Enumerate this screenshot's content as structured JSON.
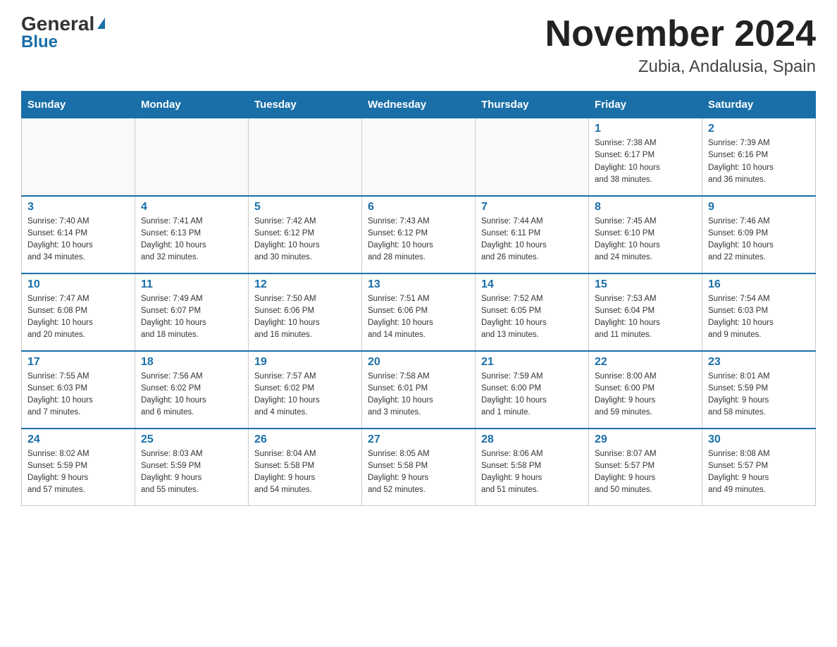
{
  "header": {
    "logo_general": "General",
    "logo_blue": "Blue",
    "title": "November 2024",
    "subtitle": "Zubia, Andalusia, Spain"
  },
  "weekdays": [
    "Sunday",
    "Monday",
    "Tuesday",
    "Wednesday",
    "Thursday",
    "Friday",
    "Saturday"
  ],
  "weeks": [
    [
      {
        "day": "",
        "info": ""
      },
      {
        "day": "",
        "info": ""
      },
      {
        "day": "",
        "info": ""
      },
      {
        "day": "",
        "info": ""
      },
      {
        "day": "",
        "info": ""
      },
      {
        "day": "1",
        "info": "Sunrise: 7:38 AM\nSunset: 6:17 PM\nDaylight: 10 hours\nand 38 minutes."
      },
      {
        "day": "2",
        "info": "Sunrise: 7:39 AM\nSunset: 6:16 PM\nDaylight: 10 hours\nand 36 minutes."
      }
    ],
    [
      {
        "day": "3",
        "info": "Sunrise: 7:40 AM\nSunset: 6:14 PM\nDaylight: 10 hours\nand 34 minutes."
      },
      {
        "day": "4",
        "info": "Sunrise: 7:41 AM\nSunset: 6:13 PM\nDaylight: 10 hours\nand 32 minutes."
      },
      {
        "day": "5",
        "info": "Sunrise: 7:42 AM\nSunset: 6:12 PM\nDaylight: 10 hours\nand 30 minutes."
      },
      {
        "day": "6",
        "info": "Sunrise: 7:43 AM\nSunset: 6:12 PM\nDaylight: 10 hours\nand 28 minutes."
      },
      {
        "day": "7",
        "info": "Sunrise: 7:44 AM\nSunset: 6:11 PM\nDaylight: 10 hours\nand 26 minutes."
      },
      {
        "day": "8",
        "info": "Sunrise: 7:45 AM\nSunset: 6:10 PM\nDaylight: 10 hours\nand 24 minutes."
      },
      {
        "day": "9",
        "info": "Sunrise: 7:46 AM\nSunset: 6:09 PM\nDaylight: 10 hours\nand 22 minutes."
      }
    ],
    [
      {
        "day": "10",
        "info": "Sunrise: 7:47 AM\nSunset: 6:08 PM\nDaylight: 10 hours\nand 20 minutes."
      },
      {
        "day": "11",
        "info": "Sunrise: 7:49 AM\nSunset: 6:07 PM\nDaylight: 10 hours\nand 18 minutes."
      },
      {
        "day": "12",
        "info": "Sunrise: 7:50 AM\nSunset: 6:06 PM\nDaylight: 10 hours\nand 16 minutes."
      },
      {
        "day": "13",
        "info": "Sunrise: 7:51 AM\nSunset: 6:06 PM\nDaylight: 10 hours\nand 14 minutes."
      },
      {
        "day": "14",
        "info": "Sunrise: 7:52 AM\nSunset: 6:05 PM\nDaylight: 10 hours\nand 13 minutes."
      },
      {
        "day": "15",
        "info": "Sunrise: 7:53 AM\nSunset: 6:04 PM\nDaylight: 10 hours\nand 11 minutes."
      },
      {
        "day": "16",
        "info": "Sunrise: 7:54 AM\nSunset: 6:03 PM\nDaylight: 10 hours\nand 9 minutes."
      }
    ],
    [
      {
        "day": "17",
        "info": "Sunrise: 7:55 AM\nSunset: 6:03 PM\nDaylight: 10 hours\nand 7 minutes."
      },
      {
        "day": "18",
        "info": "Sunrise: 7:56 AM\nSunset: 6:02 PM\nDaylight: 10 hours\nand 6 minutes."
      },
      {
        "day": "19",
        "info": "Sunrise: 7:57 AM\nSunset: 6:02 PM\nDaylight: 10 hours\nand 4 minutes."
      },
      {
        "day": "20",
        "info": "Sunrise: 7:58 AM\nSunset: 6:01 PM\nDaylight: 10 hours\nand 3 minutes."
      },
      {
        "day": "21",
        "info": "Sunrise: 7:59 AM\nSunset: 6:00 PM\nDaylight: 10 hours\nand 1 minute."
      },
      {
        "day": "22",
        "info": "Sunrise: 8:00 AM\nSunset: 6:00 PM\nDaylight: 9 hours\nand 59 minutes."
      },
      {
        "day": "23",
        "info": "Sunrise: 8:01 AM\nSunset: 5:59 PM\nDaylight: 9 hours\nand 58 minutes."
      }
    ],
    [
      {
        "day": "24",
        "info": "Sunrise: 8:02 AM\nSunset: 5:59 PM\nDaylight: 9 hours\nand 57 minutes."
      },
      {
        "day": "25",
        "info": "Sunrise: 8:03 AM\nSunset: 5:59 PM\nDaylight: 9 hours\nand 55 minutes."
      },
      {
        "day": "26",
        "info": "Sunrise: 8:04 AM\nSunset: 5:58 PM\nDaylight: 9 hours\nand 54 minutes."
      },
      {
        "day": "27",
        "info": "Sunrise: 8:05 AM\nSunset: 5:58 PM\nDaylight: 9 hours\nand 52 minutes."
      },
      {
        "day": "28",
        "info": "Sunrise: 8:06 AM\nSunset: 5:58 PM\nDaylight: 9 hours\nand 51 minutes."
      },
      {
        "day": "29",
        "info": "Sunrise: 8:07 AM\nSunset: 5:57 PM\nDaylight: 9 hours\nand 50 minutes."
      },
      {
        "day": "30",
        "info": "Sunrise: 8:08 AM\nSunset: 5:57 PM\nDaylight: 9 hours\nand 49 minutes."
      }
    ]
  ]
}
